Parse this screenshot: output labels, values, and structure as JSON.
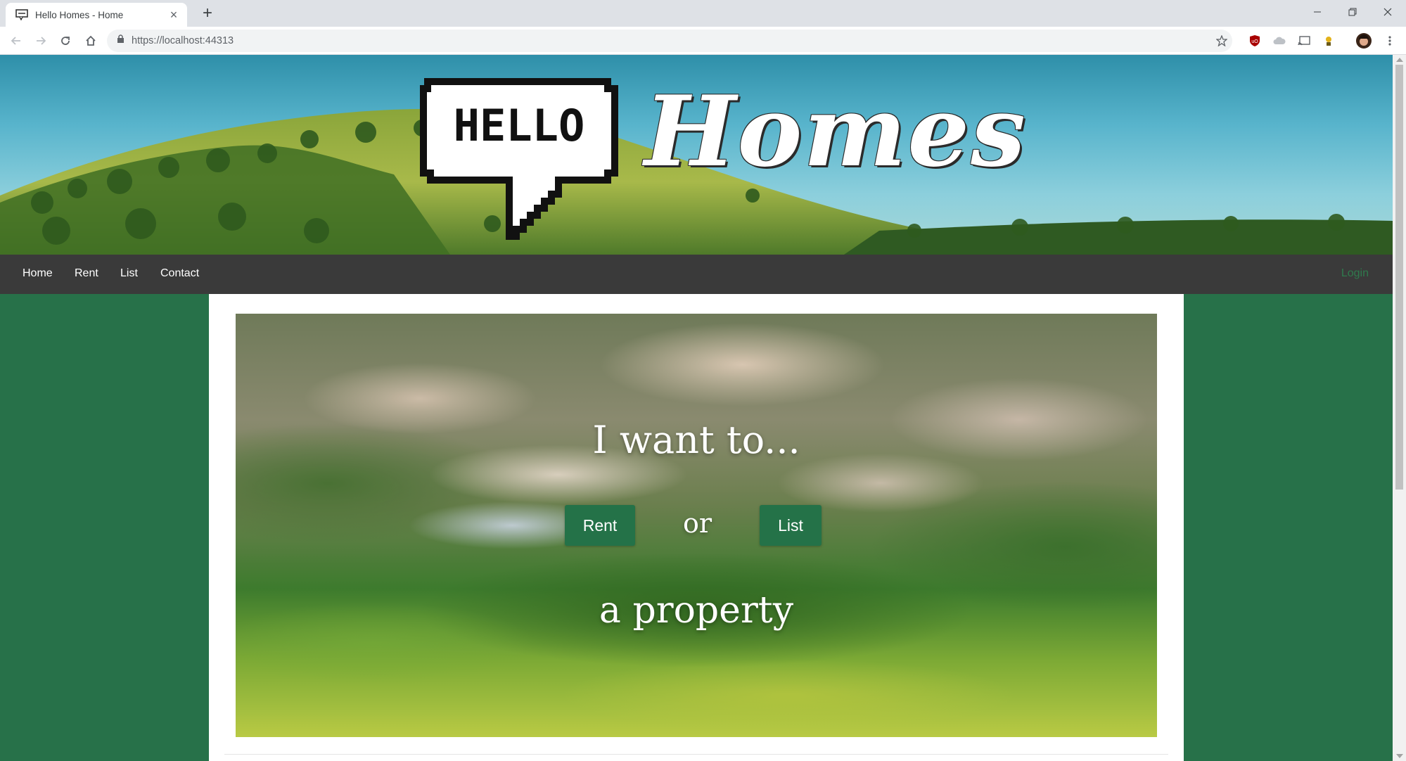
{
  "browser": {
    "tab_title": "Hello Homes - Home",
    "url": "https://localhost:44313",
    "icons": [
      "back-icon",
      "forward-icon",
      "reload-icon",
      "home-icon",
      "lock-icon",
      "star-icon",
      "ublock-icon",
      "cloud-icon",
      "cast-icon",
      "extension-icon",
      "profile-avatar",
      "menu-icon"
    ]
  },
  "banner": {
    "logo_bubble_text": "HELLO",
    "logo_word": "Homes"
  },
  "nav": {
    "items": [
      {
        "label": "Home"
      },
      {
        "label": "Rent"
      },
      {
        "label": "List"
      },
      {
        "label": "Contact"
      }
    ],
    "login_label": "Login"
  },
  "hero": {
    "title": "I want to...",
    "rent_button": "Rent",
    "or_text": "or",
    "list_button": "List",
    "subtitle": "a property"
  },
  "colors": {
    "brand_green": "#277149",
    "navbar": "#3a3a3a"
  }
}
